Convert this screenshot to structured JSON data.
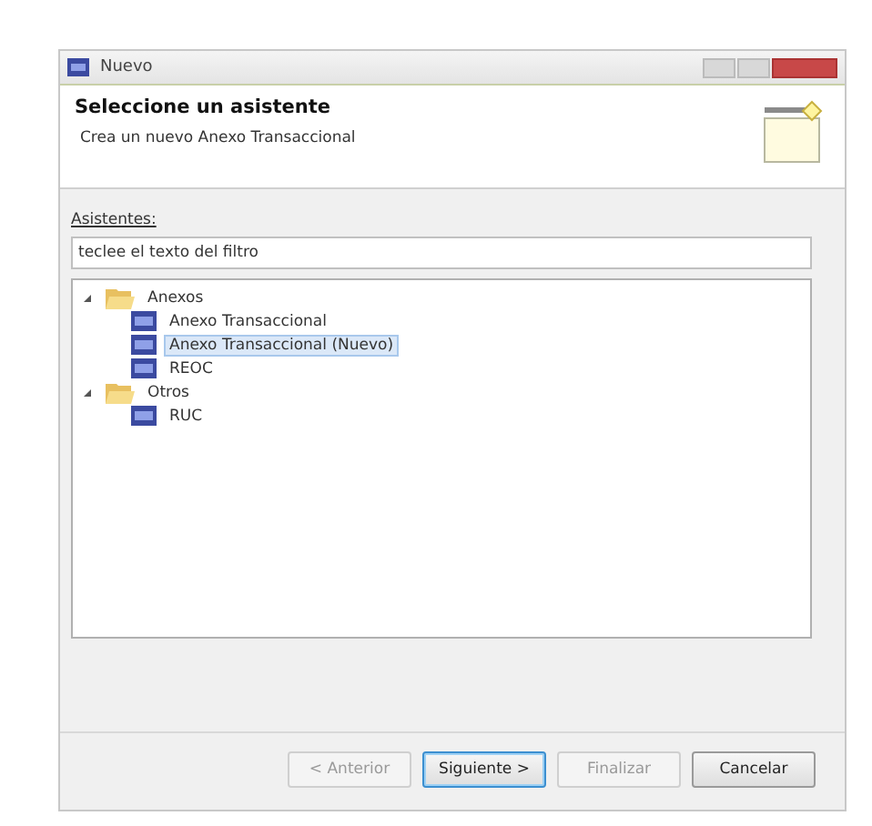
{
  "window": {
    "title": "Nuevo"
  },
  "header": {
    "title": "Seleccione un asistente",
    "description": "Crea un nuevo Anexo Transaccional"
  },
  "filter": {
    "label": "Asistentes:",
    "placeholder": "teclee el texto del filtro"
  },
  "tree": [
    {
      "kind": "folder",
      "label": "Anexos",
      "expanded": true,
      "selected": false,
      "children": [
        {
          "kind": "wizard",
          "label": "Anexo Transaccional",
          "selected": false
        },
        {
          "kind": "wizard",
          "label": "Anexo Transaccional (Nuevo)",
          "selected": true
        },
        {
          "kind": "wizard",
          "label": "REOC",
          "selected": false
        }
      ]
    },
    {
      "kind": "folder",
      "label": "Otros",
      "expanded": true,
      "selected": false,
      "children": [
        {
          "kind": "wizard",
          "label": "RUC",
          "selected": false
        }
      ]
    }
  ],
  "buttons": [
    {
      "label": "< Anterior",
      "disabled": true,
      "default": false
    },
    {
      "label": "Siguiente >",
      "disabled": false,
      "default": true
    },
    {
      "label": "Finalizar",
      "disabled": true,
      "default": false
    },
    {
      "label": "Cancelar",
      "disabled": false,
      "default": false
    }
  ]
}
